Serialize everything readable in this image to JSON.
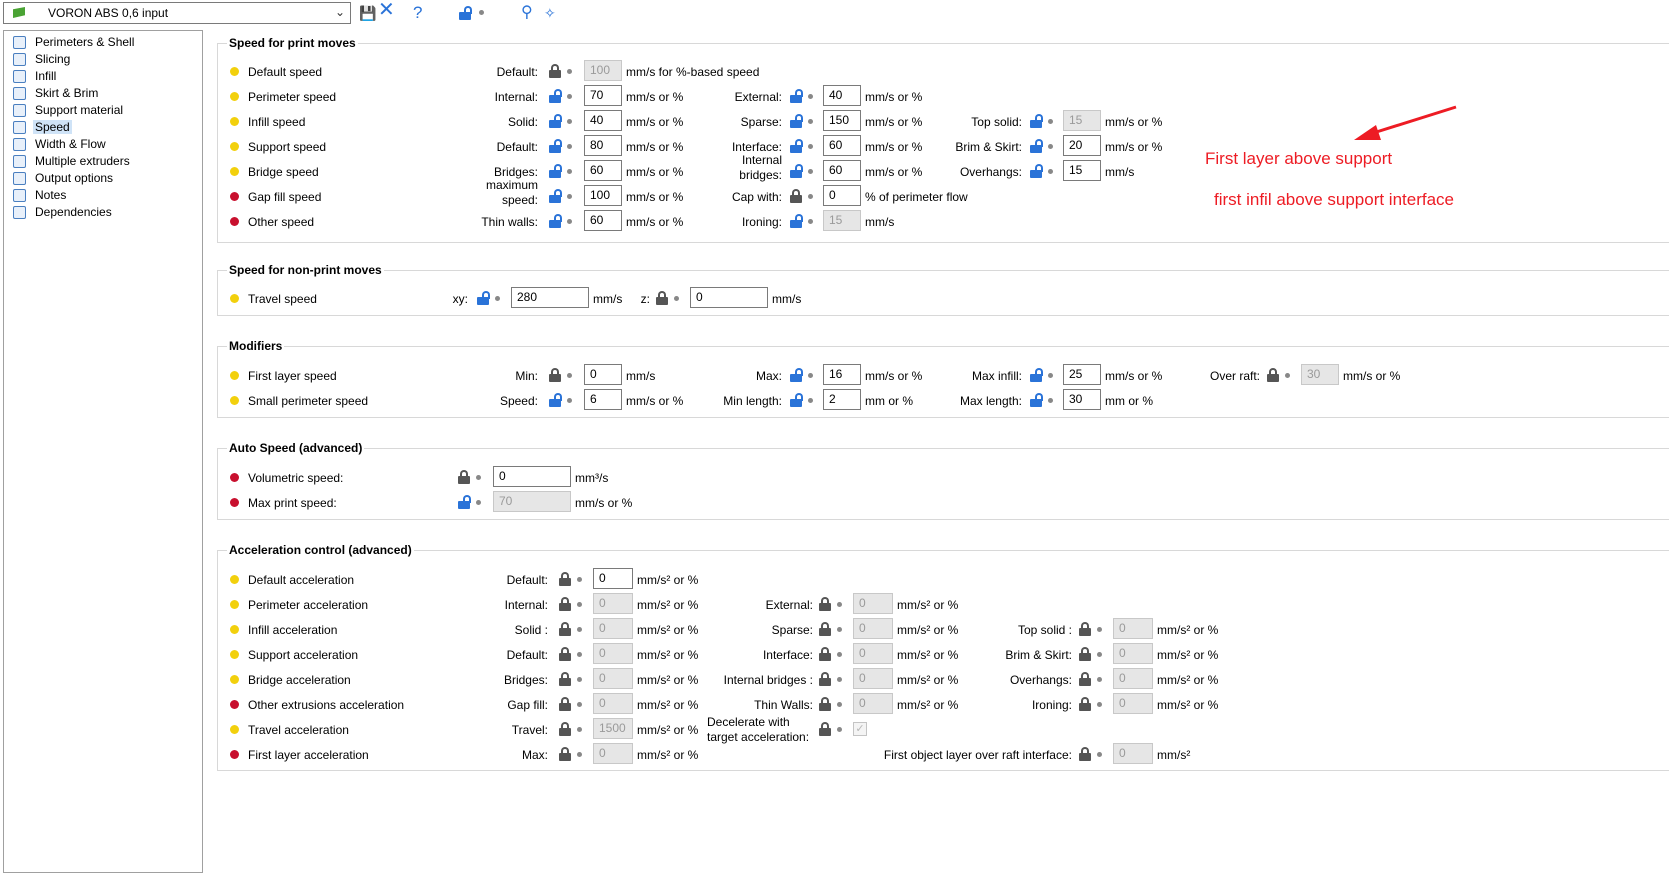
{
  "preset": {
    "name": "VORON ABS 0,6 input"
  },
  "sidebar": [
    "Perimeters & Shell",
    "Slicing",
    "Infill",
    "Skirt & Brim",
    "Support material",
    "Speed",
    "Width & Flow",
    "Multiple extruders",
    "Output options",
    "Notes",
    "Dependencies"
  ],
  "sidebar_selected": "Speed",
  "groups": {
    "print_moves": "Speed for print moves",
    "non_print": "Speed for non-print moves",
    "modifiers": "Modifiers",
    "auto": "Auto Speed (advanced)",
    "accel": "Acceleration control (advanced)"
  },
  "annotations": {
    "a1": "First layer above support",
    "a2": "first infil above support interface"
  },
  "colors": {
    "accent": "#2a73d8",
    "annotation": "#ed1c24",
    "required_dot": "#f2d00d",
    "advanced_dot": "#c8102e"
  },
  "rows": {
    "sp_default": {
      "label": "Default speed",
      "k1": "Default:",
      "v1": "100",
      "u1": "mm/s for %-based speed"
    },
    "sp_perim": {
      "label": "Perimeter speed",
      "k1": "Internal:",
      "v1": "70",
      "u1": "mm/s or %",
      "k2": "External:",
      "v2": "40",
      "u2": "mm/s or %"
    },
    "sp_infill": {
      "label": "Infill speed",
      "k1": "Solid:",
      "v1": "40",
      "u1": "mm/s or %",
      "k2": "Sparse:",
      "v2": "150",
      "u2": "mm/s or %",
      "k3": "Top solid:",
      "v3": "15",
      "u3": "mm/s or %"
    },
    "sp_support": {
      "label": "Support speed",
      "k1": "Default:",
      "v1": "80",
      "u1": "mm/s or %",
      "k2": "Interface:",
      "v2": "60",
      "u2": "mm/s or %",
      "k3": "Brim & Skirt:",
      "v3": "20",
      "u3": "mm/s or %"
    },
    "sp_bridge": {
      "label": "Bridge speed",
      "k1": "Bridges:",
      "v1": "60",
      "u1": "mm/s or %",
      "k2a": "Internal",
      "k2b": "bridges:",
      "v2": "60",
      "u2": "mm/s or %",
      "k3": "Overhangs:",
      "v3": "15",
      "u3": "mm/s"
    },
    "sp_gap": {
      "label": "Gap fill speed",
      "k1a": "maximum",
      "k1b": "speed:",
      "v1": "100",
      "u1": "mm/s or %",
      "k2": "Cap with:",
      "v2": "0",
      "u2": "% of perimeter flow"
    },
    "sp_other": {
      "label": "Other speed",
      "k1": "Thin walls:",
      "v1": "60",
      "u1": "mm/s or %",
      "k2": "Ironing:",
      "v2": "15",
      "u2": "mm/s"
    },
    "travel": {
      "label": "Travel speed",
      "k1": "xy:",
      "v1": "280",
      "u1": "mm/s",
      "k2": "z:",
      "v2": "0",
      "u2": "mm/s"
    },
    "first_layer": {
      "label": "First layer speed",
      "k1": "Min:",
      "v1": "0",
      "u1": "mm/s",
      "k2": "Max:",
      "v2": "16",
      "u2": "mm/s or %",
      "k3": "Max infill:",
      "v3": "25",
      "u3": "mm/s or %",
      "k4": "Over raft:",
      "v4": "30",
      "u4": "mm/s or %"
    },
    "small_perim": {
      "label": "Small perimeter speed",
      "k1": "Speed:",
      "v1": "6",
      "u1": "mm/s or %",
      "k2": "Min length:",
      "v2": "2",
      "u2": "mm or %",
      "k3": "Max length:",
      "v3": "30",
      "u3": "mm or %"
    },
    "volumetric": {
      "label": "Volumetric speed:",
      "v1": "0",
      "u1": "mm³/s"
    },
    "max_print": {
      "label": "Max print speed:",
      "v1": "70",
      "u1": "mm/s or %"
    },
    "ac_default": {
      "label": "Default acceleration",
      "k1": "Default:",
      "v1": "0",
      "u1": "mm/s² or %"
    },
    "ac_perim": {
      "label": "Perimeter acceleration",
      "k1": "Internal:",
      "v1": "0",
      "u1": "mm/s² or %",
      "k2": "External:",
      "v2": "0",
      "u2": "mm/s² or %"
    },
    "ac_infill": {
      "label": "Infill acceleration",
      "k1": "Solid :",
      "v1": "0",
      "u1": "mm/s² or %",
      "k2": "Sparse:",
      "v2": "0",
      "u2": "mm/s² or %",
      "k3": "Top solid :",
      "v3": "0",
      "u3": "mm/s² or %"
    },
    "ac_support": {
      "label": "Support acceleration",
      "k1": "Default:",
      "v1": "0",
      "u1": "mm/s² or %",
      "k2": "Interface:",
      "v2": "0",
      "u2": "mm/s² or %",
      "k3": "Brim & Skirt:",
      "v3": "0",
      "u3": "mm/s² or %"
    },
    "ac_bridge": {
      "label": "Bridge acceleration",
      "k1": "Bridges:",
      "v1": "0",
      "u1": "mm/s² or %",
      "k2": "Internal bridges :",
      "v2": "0",
      "u2": "mm/s² or %",
      "k3": "Overhangs:",
      "v3": "0",
      "u3": "mm/s² or %"
    },
    "ac_other": {
      "label": "Other extrusions acceleration",
      "k1": "Gap fill:",
      "v1": "0",
      "u1": "mm/s² or %",
      "k2": "Thin Walls:",
      "v2": "0",
      "u2": "mm/s² or %",
      "k3": "Ironing:",
      "v3": "0",
      "u3": "mm/s² or %"
    },
    "ac_travel": {
      "label": "Travel acceleration",
      "k1": "Travel:",
      "v1": "1500",
      "u1": "mm/s² or %",
      "k2a": "Decelerate with",
      "k2b": "target acceleration:"
    },
    "ac_first": {
      "label": "First layer acceleration",
      "k1": "Max:",
      "v1": "0",
      "u1": "mm/s² or %",
      "k2": "First object layer over raft interface:",
      "v2": "0",
      "u2": "mm/s²"
    }
  }
}
